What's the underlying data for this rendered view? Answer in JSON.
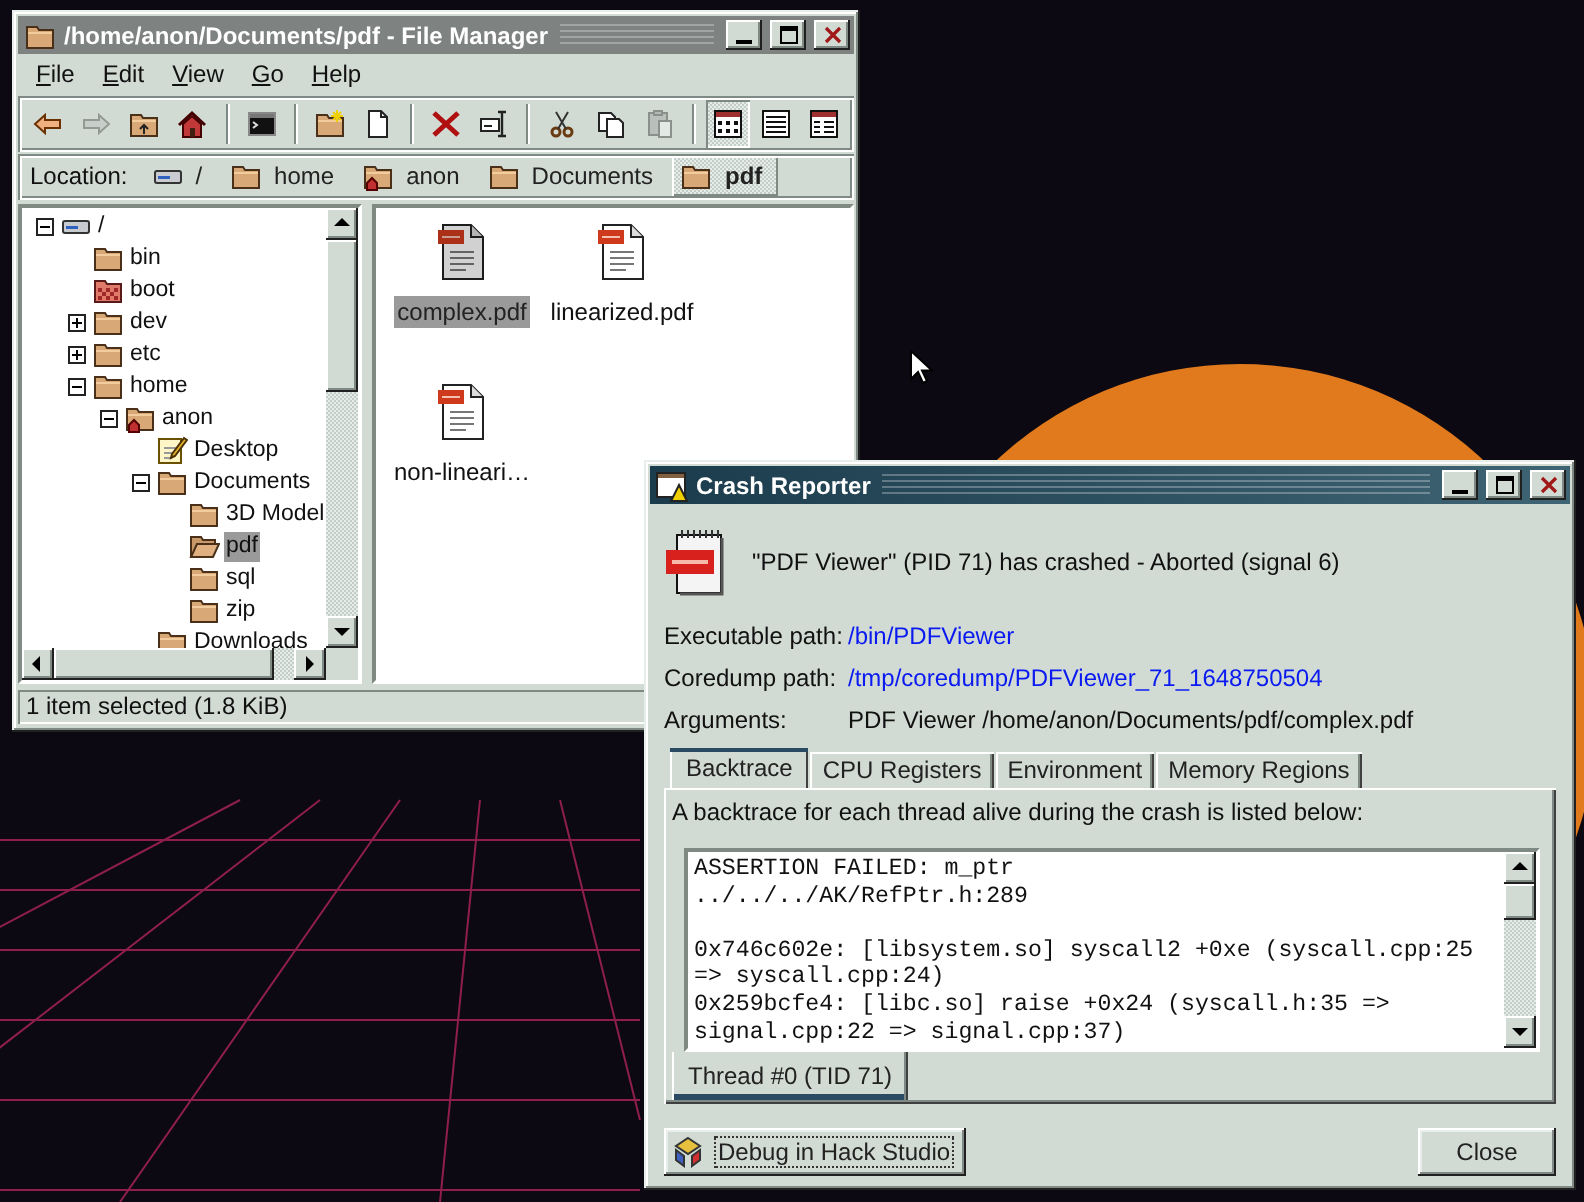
{
  "file_manager": {
    "title": "/home/anon/Documents/pdf - File Manager",
    "active": false,
    "menu": [
      "File",
      "Edit",
      "View",
      "Go",
      "Help"
    ],
    "toolbar": [
      {
        "kind": "back",
        "disabled": false
      },
      {
        "kind": "forward",
        "disabled": true
      },
      {
        "kind": "up",
        "disabled": false
      },
      {
        "kind": "home",
        "disabled": false
      },
      {
        "kind": "separator"
      },
      {
        "kind": "terminal",
        "disabled": false
      },
      {
        "kind": "separator"
      },
      {
        "kind": "new-folder",
        "disabled": false
      },
      {
        "kind": "new-file",
        "disabled": false
      },
      {
        "kind": "separator"
      },
      {
        "kind": "delete",
        "disabled": false
      },
      {
        "kind": "rename",
        "disabled": false
      },
      {
        "kind": "separator"
      },
      {
        "kind": "cut",
        "disabled": false
      },
      {
        "kind": "copy",
        "disabled": false
      },
      {
        "kind": "paste",
        "disabled": true
      },
      {
        "kind": "separator"
      },
      {
        "kind": "icon-view",
        "disabled": false,
        "selected": true
      },
      {
        "kind": "list-view",
        "disabled": false,
        "selected": false
      },
      {
        "kind": "table-view",
        "disabled": false,
        "selected": false
      }
    ],
    "location": {
      "label": "Location:",
      "crumbs": [
        {
          "label": "/",
          "kind": "drive",
          "selected": false
        },
        {
          "label": "home",
          "kind": "folder",
          "selected": false
        },
        {
          "label": "anon",
          "kind": "home-folder",
          "selected": false
        },
        {
          "label": "Documents",
          "kind": "folder",
          "selected": false
        },
        {
          "label": "pdf",
          "kind": "folder",
          "selected": true
        }
      ]
    },
    "tree": [
      {
        "label": "/",
        "kind": "drive",
        "expanded": true,
        "selected": false,
        "children": [
          {
            "label": "bin",
            "kind": "folder",
            "selected": false
          },
          {
            "label": "boot",
            "kind": "locked-folder",
            "selected": false
          },
          {
            "label": "dev",
            "kind": "folder",
            "expanded": false,
            "selected": false
          },
          {
            "label": "etc",
            "kind": "folder",
            "expanded": false,
            "selected": false
          },
          {
            "label": "home",
            "kind": "folder",
            "expanded": true,
            "selected": false,
            "children": [
              {
                "label": "anon",
                "kind": "home-folder",
                "expanded": true,
                "selected": false,
                "children": [
                  {
                    "label": "Desktop",
                    "kind": "desktop",
                    "selected": false
                  },
                  {
                    "label": "Documents",
                    "kind": "folder",
                    "expanded": true,
                    "selected": false,
                    "children": [
                      {
                        "label": "3D Model",
                        "kind": "folder",
                        "selected": false
                      },
                      {
                        "label": "pdf",
                        "kind": "open-folder",
                        "selected": true
                      },
                      {
                        "label": "sql",
                        "kind": "folder",
                        "selected": false
                      },
                      {
                        "label": "zip",
                        "kind": "folder",
                        "selected": false
                      }
                    ]
                  },
                  {
                    "label": "Downloads",
                    "kind": "folder",
                    "selected": false
                  }
                ]
              }
            ]
          }
        ]
      }
    ],
    "files": [
      {
        "name": "complex.pdf",
        "selected": true
      },
      {
        "name": "linearized.pdf",
        "selected": false
      },
      {
        "name": "non-lineari…",
        "selected": false
      }
    ],
    "status": "1 item selected (1.8 KiB)"
  },
  "crash_reporter": {
    "title": "Crash Reporter",
    "active": true,
    "message": "\"PDF Viewer\" (PID 71) has crashed - Aborted (signal 6)",
    "fields": [
      {
        "label": "Executable path:",
        "value": "/bin/PDFViewer",
        "link": true
      },
      {
        "label": "Coredump path:",
        "value": "/tmp/coredump/PDFViewer_71_1648750504",
        "link": true
      },
      {
        "label": "Arguments:",
        "value": "PDF Viewer /home/anon/Documents/pdf/complex.pdf",
        "link": false
      }
    ],
    "tabs": [
      {
        "label": "Backtrace",
        "selected": true
      },
      {
        "label": "CPU Registers",
        "selected": false
      },
      {
        "label": "Environment",
        "selected": false
      },
      {
        "label": "Memory Regions",
        "selected": false
      }
    ],
    "description": "A backtrace for each thread alive during the crash is listed below:",
    "backtrace": {
      "message": "ASSERTION FAILED: m_ptr\n../../../AK/RefPtr.h:289",
      "frames": [
        "0x746c602e: [libsystem.so] syscall2 +0xe (syscall.cpp:25\n=> syscall.cpp:24)",
        "0x259bcfe4: [libc.so] raise +0x24 (syscall.h:35 =>\nsignal.cpp:22 => signal.cpp:37)"
      ]
    },
    "threads": [
      {
        "label": "Thread #0 (TID 71)",
        "selected": true
      }
    ],
    "buttons": [
      {
        "label": "Debug in Hack Studio",
        "kind": "debug",
        "focused": true
      },
      {
        "label": "Close",
        "kind": "close",
        "focused": false
      }
    ]
  }
}
